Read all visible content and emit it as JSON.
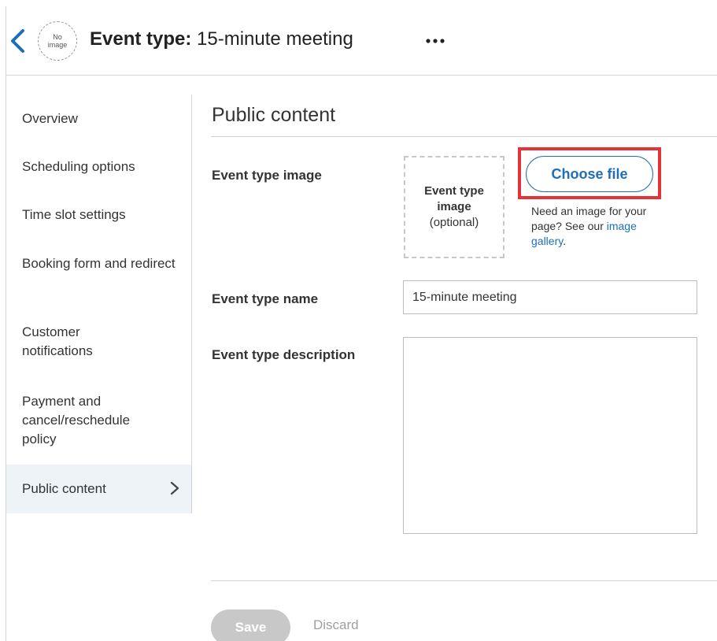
{
  "header": {
    "back_icon": "chevron-left-icon",
    "avatar_text": "No image",
    "title_prefix": "Event type:",
    "title_name": "15-minute meeting",
    "more_icon": "ellipsis-icon"
  },
  "sidebar": {
    "items": [
      {
        "label": "Overview"
      },
      {
        "label": "Scheduling options"
      },
      {
        "label": "Time slot settings"
      },
      {
        "label": "Booking form and redirect"
      },
      {
        "label": "Customer notifications"
      },
      {
        "label": "Payment and cancel/reschedule policy"
      },
      {
        "label": "Public content",
        "active": true
      }
    ],
    "active_icon": "chevron-right-icon"
  },
  "main": {
    "title": "Public content",
    "image_field": {
      "label": "Event type image",
      "box_bold": "Event type image",
      "box_optional": "(optional)",
      "choose_button": "Choose file",
      "help_text": "Need an image for your page? See our",
      "help_link": "image gallery",
      "help_tail": "."
    },
    "name_field": {
      "label": "Event type name",
      "value": "15-minute meeting"
    },
    "description_field": {
      "label": "Event type description",
      "value": ""
    }
  },
  "footer": {
    "save_label": "Save",
    "discard_label": "Discard"
  },
  "colors": {
    "accent": "#1f6fb8",
    "highlight_border": "#e5333a",
    "active_nav_bg": "#eef3f8",
    "disabled_button": "#c8c8c8"
  }
}
